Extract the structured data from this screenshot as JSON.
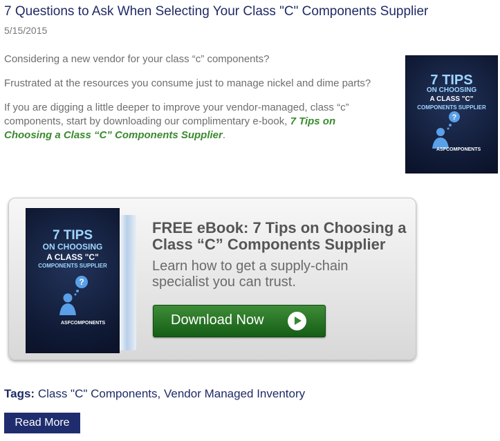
{
  "post": {
    "title": "7 Questions to Ask When Selecting Your Class \"C\" Components Supplier",
    "date": "5/15/2015",
    "paragraphs": {
      "p1": "Considering a new vendor for your class “c” components?",
      "p2": "Frustrated at the resources you consume just to manage nickel and dime parts?",
      "p3_before": "If you are digging a little deeper to improve your vendor-managed, class “c” components, start by downloading our complimentary e-book, ",
      "p3_link": "7 Tips on Choosing a Class “C” Components Supplier",
      "p3_after": "."
    }
  },
  "cover": {
    "line1": "7 TIPS",
    "line2": "ON CHOOSING",
    "line3": "A CLASS \"C\"",
    "line4": "COMPONENTS SUPPLIER",
    "logo": "ASFCOMPONENTS"
  },
  "banner": {
    "headline": "FREE eBook: 7 Tips on Choosing a Class “C” Components Supplier",
    "subline": "Learn how to get a supply-chain specialist you can trust.",
    "button_label": "Download Now"
  },
  "tags": {
    "label": "Tags:",
    "items": {
      "t1": "Class \"C\" Components",
      "sep": ",",
      "t2": "Vendor Managed Inventory"
    }
  },
  "read_more_label": "Read More",
  "colors": {
    "title": "#1f2a66",
    "link_green": "#3a8a2e",
    "button_green": "#2f8b2f",
    "read_more_bg": "#1f2d6e"
  }
}
